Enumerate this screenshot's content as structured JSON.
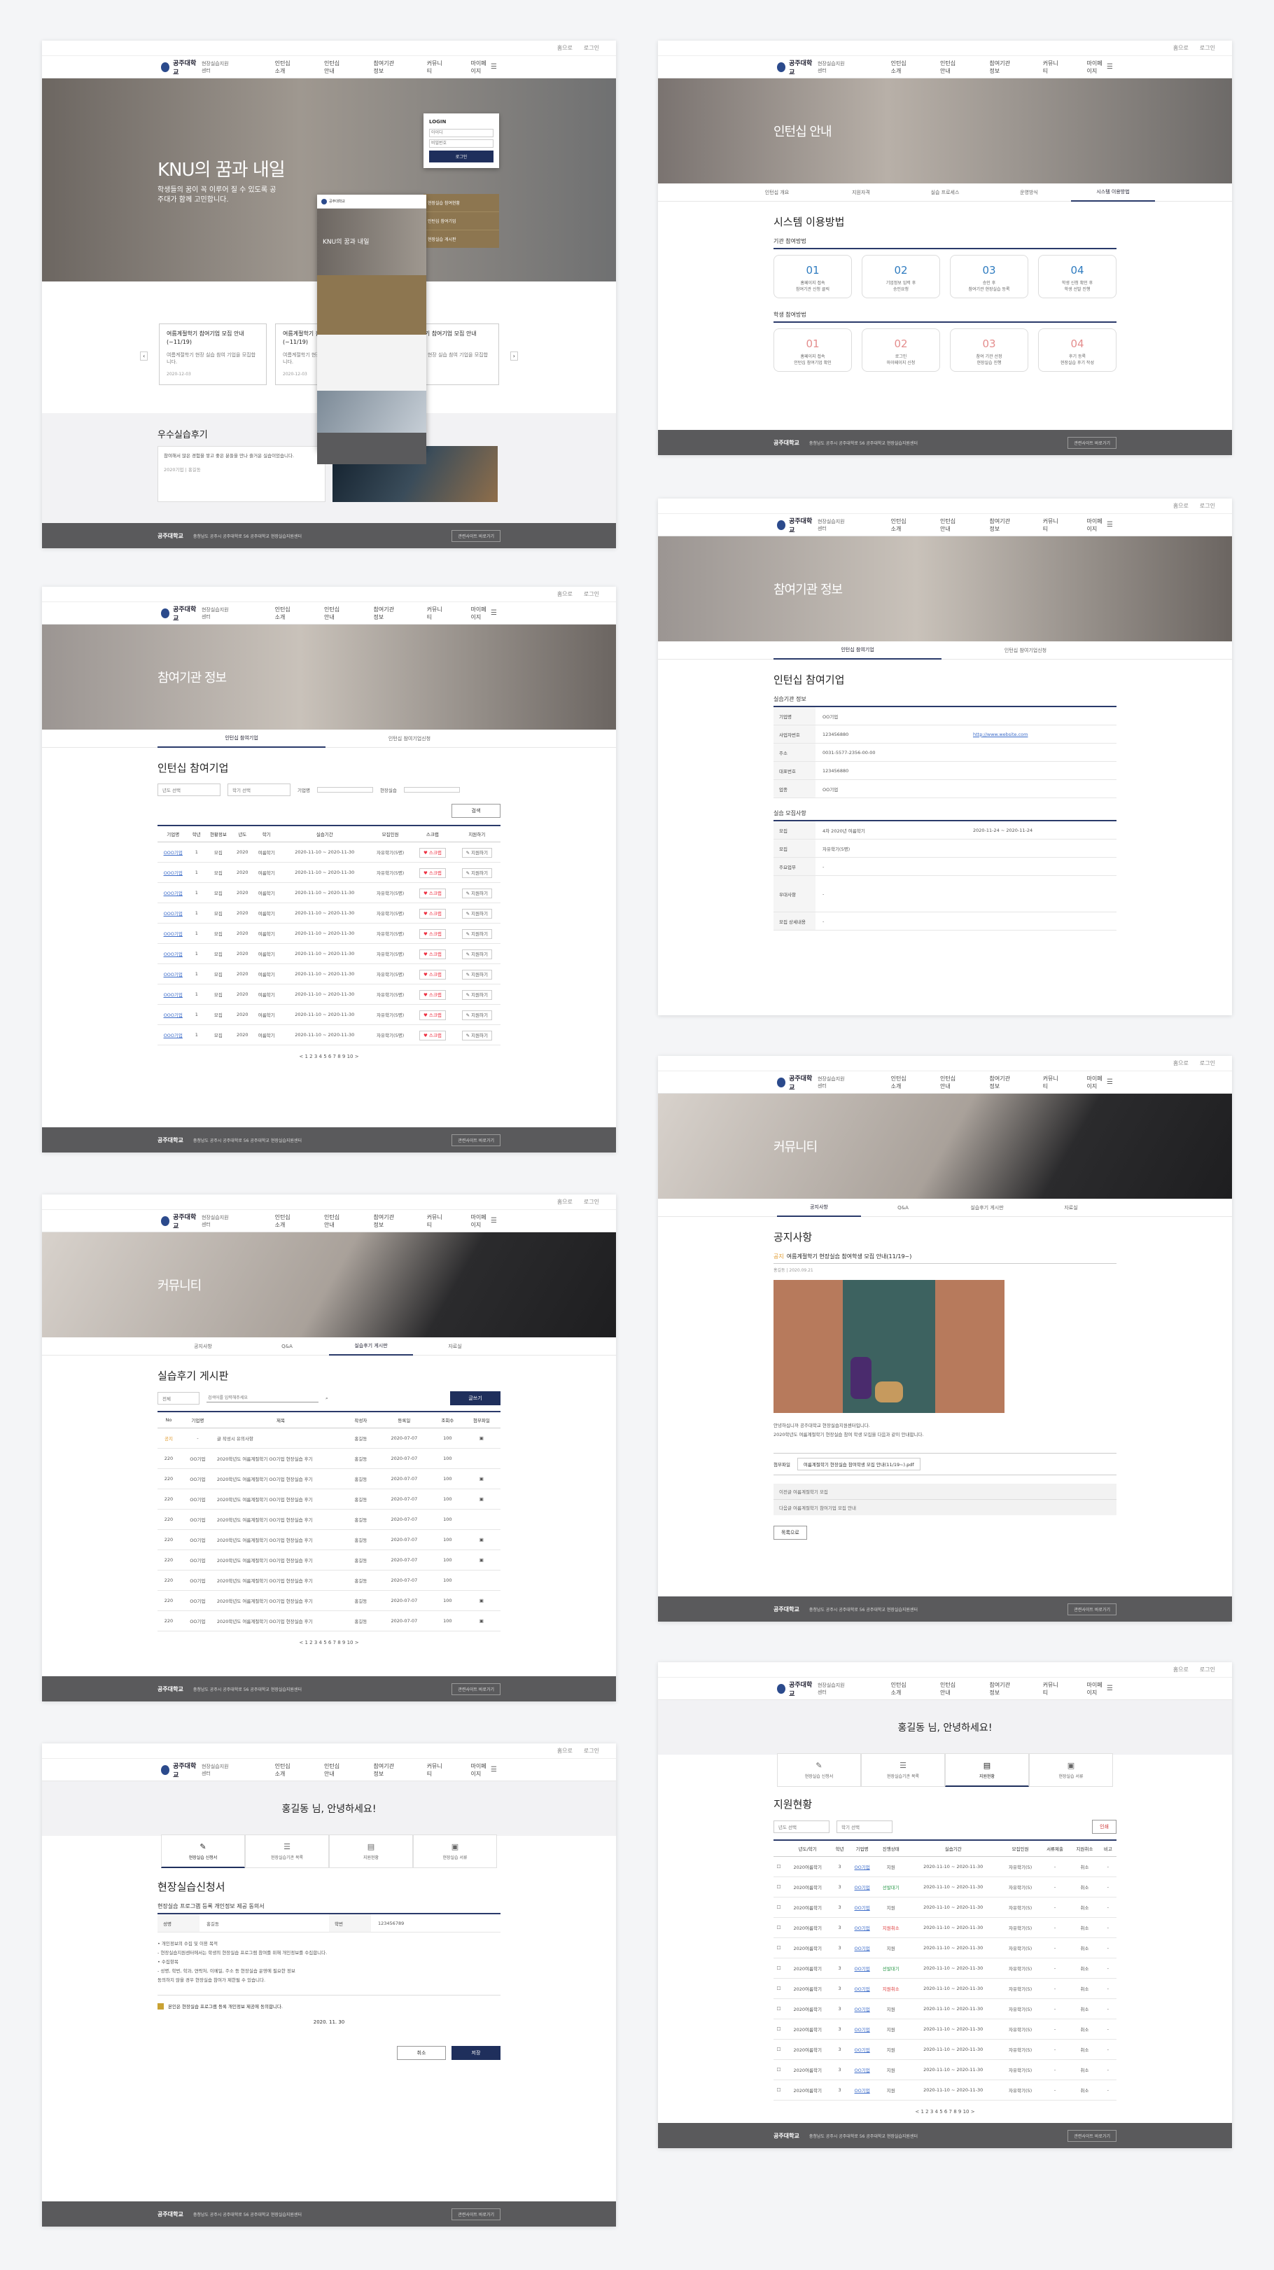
{
  "common": {
    "util_home": "홈으로",
    "util_login": "로그인",
    "logo": "공주대학교",
    "logo_sub": "현장실습지원센터",
    "menu": [
      "인턴십 소개",
      "인턴십 안내",
      "참여기관 정보",
      "커뮤니티",
      "마이페이지"
    ],
    "footer_logo": "공주대학교",
    "footer_text": "충청남도 공주시 공주대학로 56 공주대학교 현장실습지원센터",
    "footer_btn": "관련사이트 바로가기"
  },
  "p1": {
    "hero_title": "KNU의 꿈과 내일",
    "hero_sub": "학생들의 꿈이 꼭 이루어 질 수 있도록 공주대가 함께 고민합니다.",
    "login_title": "LOGIN",
    "id_placeholder": "아이디",
    "pw_placeholder": "비밀번호",
    "login_btn": "로그인",
    "quick": [
      "현장실습 참여현황",
      "인턴십 참여기업",
      "현장실습 게시판"
    ],
    "cards": [
      {
        "title": "여름계절학기 참여기업 모집 안내(~11/19)",
        "body": "여름계절학기 현장 실습 참여 기업을 모집합니다.",
        "date": "2020-12-03"
      },
      {
        "title": "여름계절학기 참여기업 모집 안내(~11/19)",
        "body": "여름계절학기 현장 실습 참여 기업을 모집합니다.",
        "date": "2020-12-03"
      },
      {
        "title": "여름계절학기 참여기업 모집 안내(~11/19)",
        "body": "여름계절학기 현장 실습 참여 기업을 모집합니다.",
        "date": "2020-12-03"
      }
    ],
    "review_title": "우수실습후기",
    "review_body": "참여해서 많은 경험을 쌓고 좋은 분들을 만나 즐거운 실습이었습니다.",
    "review_meta": "2020기업 | 홍길동"
  },
  "p2": {
    "hero": "인턴십 안내",
    "tabs": [
      "인턴십 개요",
      "지원자격",
      "실습 프로세스",
      "운영방식",
      "시스템 이용방법"
    ],
    "active_tab": 4,
    "title": "시스템 이용방법",
    "sec1": "기관 참여방법",
    "flow1": [
      {
        "no": "01",
        "t": "홈페이지 접속",
        "d": "참여기관 신청 클릭"
      },
      {
        "no": "02",
        "t": "기업정보 입력 후",
        "d": "승인요청"
      },
      {
        "no": "03",
        "t": "승인 후",
        "d": "참여기관 현장실습 등록"
      },
      {
        "no": "04",
        "t": "학생 신청 확인 후",
        "d": "학생 선발 진행"
      }
    ],
    "sec2": "학생 참여방법",
    "flow2": [
      {
        "no": "01",
        "t": "홈페이지 접속",
        "d": "인턴십 참여기업 확인"
      },
      {
        "no": "02",
        "t": "로그인",
        "d": "마이페이지 신청"
      },
      {
        "no": "03",
        "t": "참여 기관 선정",
        "d": "현장실습 진행"
      },
      {
        "no": "04",
        "t": "후기 등록",
        "d": "현장실습 후기 작성"
      }
    ]
  },
  "p3": {
    "hero": "참여기관 정보",
    "tabs": [
      "인턴십 참여기업",
      "인턴십 참여기업신청"
    ],
    "title": "인턴십 참여기업",
    "filters": [
      "년도 선택",
      "학기 선택",
      "기업명",
      "현장실습"
    ],
    "search_btn": "검색",
    "cols": [
      "기업명",
      "학년",
      "현황정보",
      "년도",
      "학기",
      "실습기간",
      "모집인원",
      "스크랩",
      "지원하기"
    ],
    "rows": [
      [
        "OOO기업",
        "1",
        "모집",
        "2020",
        "여름학기",
        "2020-11-10 ~ 2020-11-30",
        "자유학기(5명)",
        "스크랩",
        "지원하기"
      ],
      [
        "OOO기업",
        "1",
        "모집",
        "2020",
        "여름학기",
        "2020-11-10 ~ 2020-11-30",
        "자유학기(5명)",
        "스크랩",
        "지원하기"
      ],
      [
        "OOO기업",
        "1",
        "모집",
        "2020",
        "여름학기",
        "2020-11-10 ~ 2020-11-30",
        "자유학기(5명)",
        "스크랩",
        "지원하기"
      ],
      [
        "OOO기업",
        "1",
        "모집",
        "2020",
        "여름학기",
        "2020-11-10 ~ 2020-11-30",
        "자유학기(5명)",
        "스크랩",
        "지원하기"
      ],
      [
        "OOO기업",
        "1",
        "모집",
        "2020",
        "여름학기",
        "2020-11-10 ~ 2020-11-30",
        "자유학기(5명)",
        "스크랩",
        "지원하기"
      ],
      [
        "OOO기업",
        "1",
        "모집",
        "2020",
        "여름학기",
        "2020-11-10 ~ 2020-11-30",
        "자유학기(5명)",
        "스크랩",
        "지원하기"
      ],
      [
        "OOO기업",
        "1",
        "모집",
        "2020",
        "여름학기",
        "2020-11-10 ~ 2020-11-30",
        "자유학기(5명)",
        "스크랩",
        "지원하기"
      ],
      [
        "OOO기업",
        "1",
        "모집",
        "2020",
        "여름학기",
        "2020-11-10 ~ 2020-11-30",
        "자유학기(5명)",
        "스크랩",
        "지원하기"
      ],
      [
        "OOO기업",
        "1",
        "모집",
        "2020",
        "여름학기",
        "2020-11-10 ~ 2020-11-30",
        "자유학기(5명)",
        "스크랩",
        "지원하기"
      ],
      [
        "OOO기업",
        "1",
        "모집",
        "2020",
        "여름학기",
        "2020-11-10 ~ 2020-11-30",
        "자유학기(5명)",
        "스크랩",
        "지원하기"
      ]
    ],
    "pager": "< 1 2 3 4 5 6 7 8 9 10 >"
  },
  "p4": {
    "hero": "참여기관 정보",
    "tabs": [
      "인턴십 참여기업",
      "인턴십 참여기업신청"
    ],
    "title": "인턴십 참여기업",
    "sec1": "실습기관 정보",
    "rows1": [
      [
        "기업명",
        "OO기업"
      ],
      [
        "사업자번호",
        "123456880"
      ],
      [
        "주소",
        "0031-5577-2356-00-00"
      ],
      [
        "대표번호",
        "123456880"
      ],
      [
        "업종",
        "OO기업"
      ]
    ],
    "homepage": "http://www.website.com",
    "sec2": "실습 모집사항",
    "rows2": [
      [
        "모집",
        "4차 2020년 여름학기"
      ],
      [
        "모집",
        "자유학기(5명)"
      ],
      [
        "주요업무",
        "-"
      ],
      [
        "우대사항",
        "-"
      ],
      [
        "모집 상세내용",
        "-"
      ]
    ],
    "period": "2020-11-24 ~ 2020-11-24"
  },
  "p5": {
    "hero": "커뮤니티",
    "tabs": [
      "공지사항",
      "Q&A",
      "실습후기 게시판",
      "자료실"
    ],
    "title": "공지사항",
    "post_title": "여름계절학기 현장실습 참여학생 모집 안내(11/19~)",
    "post_tag": "공지",
    "post_meta": "홍길동 | 2020.09.21",
    "body1": "안녕하십니까 공주대학교 현장실습지원센터입니다.",
    "body2": "2020학년도 여름계절학기 현장실습 참여 학생 모집을 다음과 같이 안내합니다.",
    "attach_label": "첨부파일",
    "attach": "여름계절학기 현장실습 참여학생 모집 안내(11/19~).pdf",
    "prev": "이전글  여름계절학기 모집",
    "next": "다음글  여름계절학기 참여기업 모집 안내",
    "list_btn": "목록으로"
  },
  "p6": {
    "hero": "커뮤니티",
    "tabs": [
      "공지사항",
      "Q&A",
      "실습후기 게시판",
      "자료실"
    ],
    "title": "실습후기 게시판",
    "search_placeholder": "검색어를 입력해주세요",
    "write_btn": "글쓰기",
    "cols": [
      "No",
      "기업명",
      "제목",
      "작성자",
      "등록일",
      "조회수",
      "첨부파일"
    ],
    "rows": [
      [
        "공지",
        "-",
        "글 작성시 유의사항",
        "홍길동",
        "2020-07-07",
        "100"
      ],
      [
        "220",
        "OO기업",
        "2020학년도 여름계절학기 OO기업 현장실습 후기",
        "홍길동",
        "2020-07-07",
        "100"
      ],
      [
        "220",
        "OO기업",
        "2020학년도 여름계절학기 OO기업 현장실습 후기",
        "홍길동",
        "2020-07-07",
        "100"
      ],
      [
        "220",
        "OO기업",
        "2020학년도 여름계절학기 OO기업 현장실습 후기",
        "홍길동",
        "2020-07-07",
        "100"
      ],
      [
        "220",
        "OO기업",
        "2020학년도 여름계절학기 OO기업 현장실습 후기",
        "홍길동",
        "2020-07-07",
        "100"
      ],
      [
        "220",
        "OO기업",
        "2020학년도 여름계절학기 OO기업 현장실습 후기",
        "홍길동",
        "2020-07-07",
        "100"
      ],
      [
        "220",
        "OO기업",
        "2020학년도 여름계절학기 OO기업 현장실습 후기",
        "홍길동",
        "2020-07-07",
        "100"
      ],
      [
        "220",
        "OO기업",
        "2020학년도 여름계절학기 OO기업 현장실습 후기",
        "홍길동",
        "2020-07-07",
        "100"
      ],
      [
        "220",
        "OO기업",
        "2020학년도 여름계절학기 OO기업 현장실습 후기",
        "홍길동",
        "2020-07-07",
        "100"
      ],
      [
        "220",
        "OO기업",
        "2020학년도 여름계절학기 OO기업 현장실습 후기",
        "홍길동",
        "2020-07-07",
        "100"
      ]
    ],
    "pager": "< 1 2 3 4 5 6 7 8 9 10 >"
  },
  "p7": {
    "welcome": "홍길동 님, 안녕하세요!",
    "mtabs": [
      "현장실습 신청서",
      "현장실습기관 목록",
      "지원현황",
      "현장실습 서류"
    ],
    "title": "지원현황",
    "cols": [
      "년도/학기",
      "학년",
      "기업명",
      "진행상태",
      "실습기간",
      "모집인원",
      "서류제출",
      "지원취소",
      "비고"
    ],
    "rows": [
      [
        "2020여름학기",
        "3",
        "OO기업",
        "지원",
        "2020-11-10 ~ 2020-11-30",
        "자유학기(5)",
        "-",
        "취소",
        "-"
      ],
      [
        "2020여름학기",
        "3",
        "OO기업",
        "선발대기",
        "2020-11-10 ~ 2020-11-30",
        "자유학기(5)",
        "-",
        "취소",
        "-"
      ],
      [
        "2020여름학기",
        "3",
        "OO기업",
        "지원",
        "2020-11-10 ~ 2020-11-30",
        "자유학기(5)",
        "-",
        "취소",
        "-"
      ],
      [
        "2020여름학기",
        "3",
        "OO기업",
        "지원취소",
        "2020-11-10 ~ 2020-11-30",
        "자유학기(5)",
        "-",
        "취소",
        "-"
      ],
      [
        "2020여름학기",
        "3",
        "OO기업",
        "지원",
        "2020-11-10 ~ 2020-11-30",
        "자유학기(5)",
        "-",
        "취소",
        "-"
      ],
      [
        "2020여름학기",
        "3",
        "OO기업",
        "선발대기",
        "2020-11-10 ~ 2020-11-30",
        "자유학기(5)",
        "-",
        "취소",
        "-"
      ],
      [
        "2020여름학기",
        "3",
        "OO기업",
        "지원취소",
        "2020-11-10 ~ 2020-11-30",
        "자유학기(5)",
        "-",
        "취소",
        "-"
      ],
      [
        "2020여름학기",
        "3",
        "OO기업",
        "지원",
        "2020-11-10 ~ 2020-11-30",
        "자유학기(5)",
        "-",
        "취소",
        "-"
      ],
      [
        "2020여름학기",
        "3",
        "OO기업",
        "지원",
        "2020-11-10 ~ 2020-11-30",
        "자유학기(5)",
        "-",
        "취소",
        "-"
      ],
      [
        "2020여름학기",
        "3",
        "OO기업",
        "지원",
        "2020-11-10 ~ 2020-11-30",
        "자유학기(5)",
        "-",
        "취소",
        "-"
      ],
      [
        "2020여름학기",
        "3",
        "OO기업",
        "지원",
        "2020-11-10 ~ 2020-11-30",
        "자유학기(5)",
        "-",
        "취소",
        "-"
      ],
      [
        "2020여름학기",
        "3",
        "OO기업",
        "지원",
        "2020-11-10 ~ 2020-11-30",
        "자유학기(5)",
        "-",
        "취소",
        "-"
      ]
    ],
    "pager": "< 1 2 3 4 5 6 7 8 9 10 >"
  },
  "p8": {
    "welcome": "홍길동 님, 안녕하세요!",
    "mtabs": [
      "현장실습 신청서",
      "현장실습기관 목록",
      "지원현황",
      "현장실습 서류"
    ],
    "title": "현장실습신청서",
    "sub": "현장실습 프로그램 등록 개인정보 제공 동의서",
    "name_k": "성명",
    "name_v": "홍길동",
    "id_k": "학번",
    "id_v": "123456789",
    "p1": "• 개인정보의 수집 및 이용 목적",
    "p2": "- 현장실습지원센터에서는 학생의 현장실습 프로그램 참여를 위해 개인정보를 수집합니다.",
    "p3": "• 수집항목",
    "p4": "- 성명, 학번, 학과, 연락처, 이메일, 주소 등 현장실습 운영에 필요한 정보",
    "p5": "동의하지 않을 경우 현장실습 참여가 제한될 수 있습니다.",
    "agree": "본인은 현장실습 프로그램 등록 개인정보 제공에 동의합니다.",
    "date": "2020. 11. 30",
    "cancel": "취소",
    "submit": "저장"
  }
}
